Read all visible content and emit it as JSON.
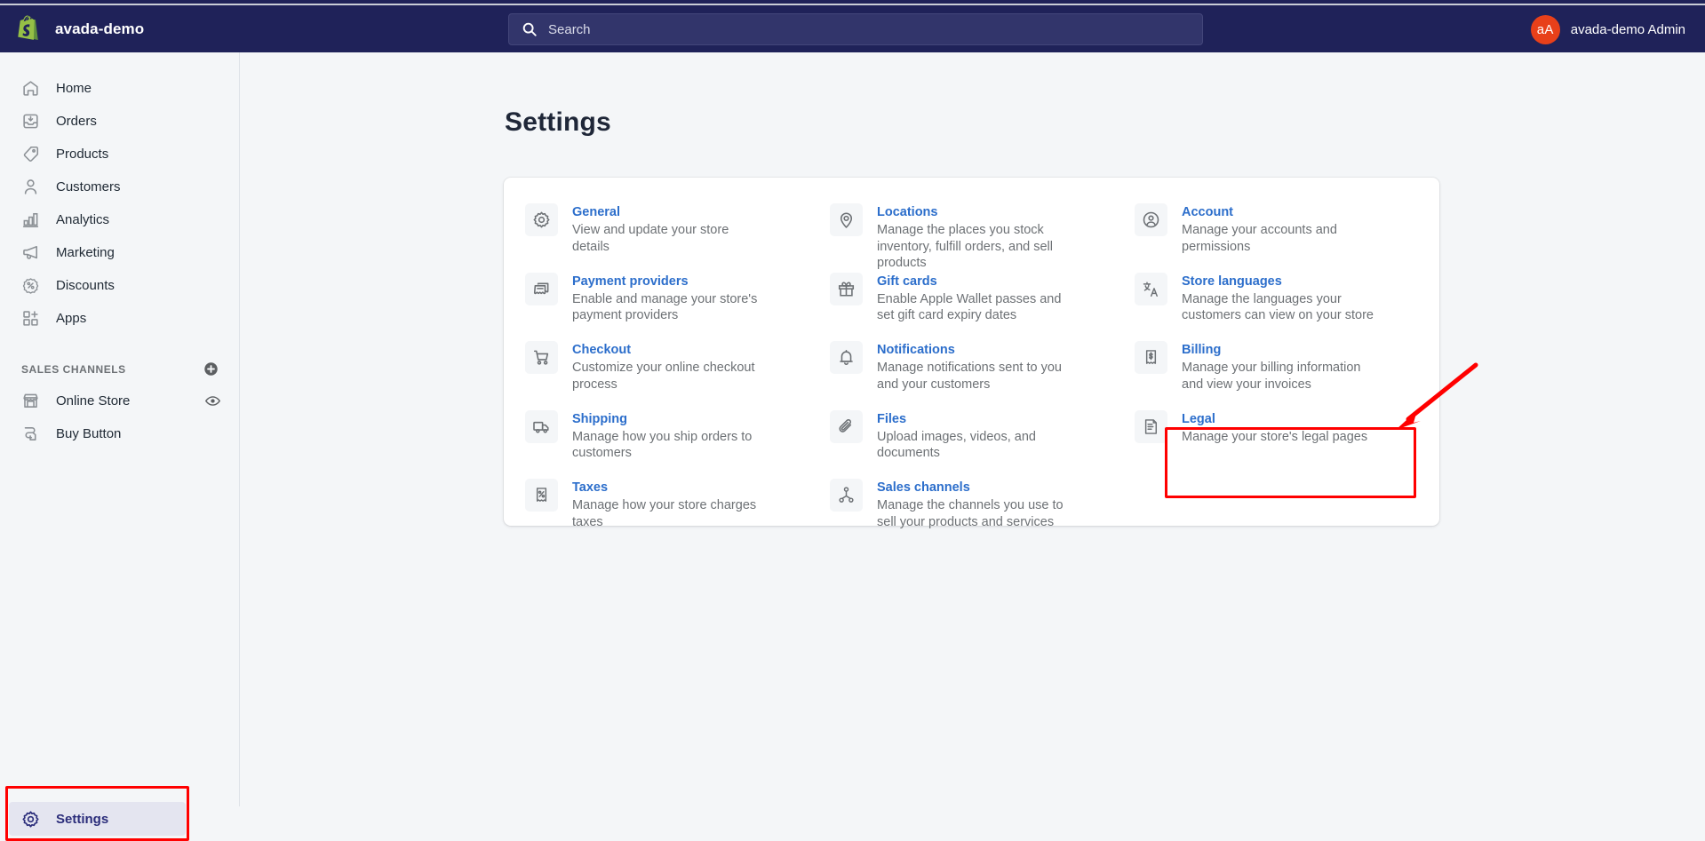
{
  "topbar": {
    "store_name": "avada-demo",
    "logo_icon": "shopify-bag-icon",
    "search": {
      "icon": "search-icon",
      "placeholder": "Search",
      "value": ""
    },
    "user": {
      "avatar_initials": "aA",
      "name": "avada-demo Admin",
      "avatar_color": "#E8401A"
    },
    "background_color": "#1F2259"
  },
  "sidebar": {
    "items": [
      {
        "label": "Home",
        "icon": "home-icon"
      },
      {
        "label": "Orders",
        "icon": "orders-inbox-icon"
      },
      {
        "label": "Products",
        "icon": "tag-icon"
      },
      {
        "label": "Customers",
        "icon": "person-icon"
      },
      {
        "label": "Analytics",
        "icon": "bar-chart-icon"
      },
      {
        "label": "Marketing",
        "icon": "megaphone-icon"
      },
      {
        "label": "Discounts",
        "icon": "percent-badge-icon"
      },
      {
        "label": "Apps",
        "icon": "apps-grid-plus-icon"
      }
    ],
    "sales_channels": {
      "title": "SALES CHANNELS",
      "add_icon": "plus-circle-icon",
      "items": [
        {
          "label": "Online Store",
          "icon": "storefront-icon",
          "trailing_icon": "eye-icon"
        },
        {
          "label": "Buy Button",
          "icon": "buy-button-icon",
          "trailing_icon": ""
        }
      ]
    },
    "settings": {
      "label": "Settings",
      "icon": "gear-icon",
      "active": true,
      "active_bg": "#E4E5F0",
      "active_fg": "#2C2E7B",
      "highlighted": true,
      "highlight_color": "#FF0000"
    }
  },
  "main": {
    "page_title": "Settings",
    "highlight_color": "#FF0000",
    "annotation_arrow": {
      "color": "#FF0000",
      "points_to": "Legal"
    },
    "settings_grid": [
      {
        "title": "General",
        "description": "View and update your store details",
        "icon": "gear-icon"
      },
      {
        "title": "Locations",
        "description": "Manage the places you stock inventory, fulfill orders, and sell products",
        "icon": "location-pin-icon"
      },
      {
        "title": "Account",
        "description": "Manage your accounts and permissions",
        "icon": "account-circle-icon"
      },
      {
        "title": "Payment providers",
        "description": "Enable and manage your store's payment providers",
        "icon": "payment-card-icon"
      },
      {
        "title": "Gift cards",
        "description": "Enable Apple Wallet passes and set gift card expiry dates",
        "icon": "gift-icon"
      },
      {
        "title": "Store languages",
        "description": "Manage the languages your customers can view on your store",
        "icon": "translate-icon"
      },
      {
        "title": "Checkout",
        "description": "Customize your online checkout process",
        "icon": "shopping-cart-icon"
      },
      {
        "title": "Notifications",
        "description": "Manage notifications sent to you and your customers",
        "icon": "bell-icon"
      },
      {
        "title": "Billing",
        "description": "Manage your billing information and view your invoices",
        "icon": "receipt-dollar-icon"
      },
      {
        "title": "Shipping",
        "description": "Manage how you ship orders to customers",
        "icon": "truck-icon"
      },
      {
        "title": "Files",
        "description": "Upload images, videos, and documents",
        "icon": "paperclip-icon"
      },
      {
        "title": "Legal",
        "description": "Manage your store's legal pages",
        "icon": "legal-scroll-icon",
        "highlighted": true
      },
      {
        "title": "Taxes",
        "description": "Manage how your store charges taxes",
        "icon": "receipt-percent-icon"
      },
      {
        "title": "Sales channels",
        "description": "Manage the channels you use to sell your products and services",
        "icon": "channels-node-icon"
      }
    ],
    "link_color": "#2C6ECB",
    "description_color": "#6D7175"
  }
}
